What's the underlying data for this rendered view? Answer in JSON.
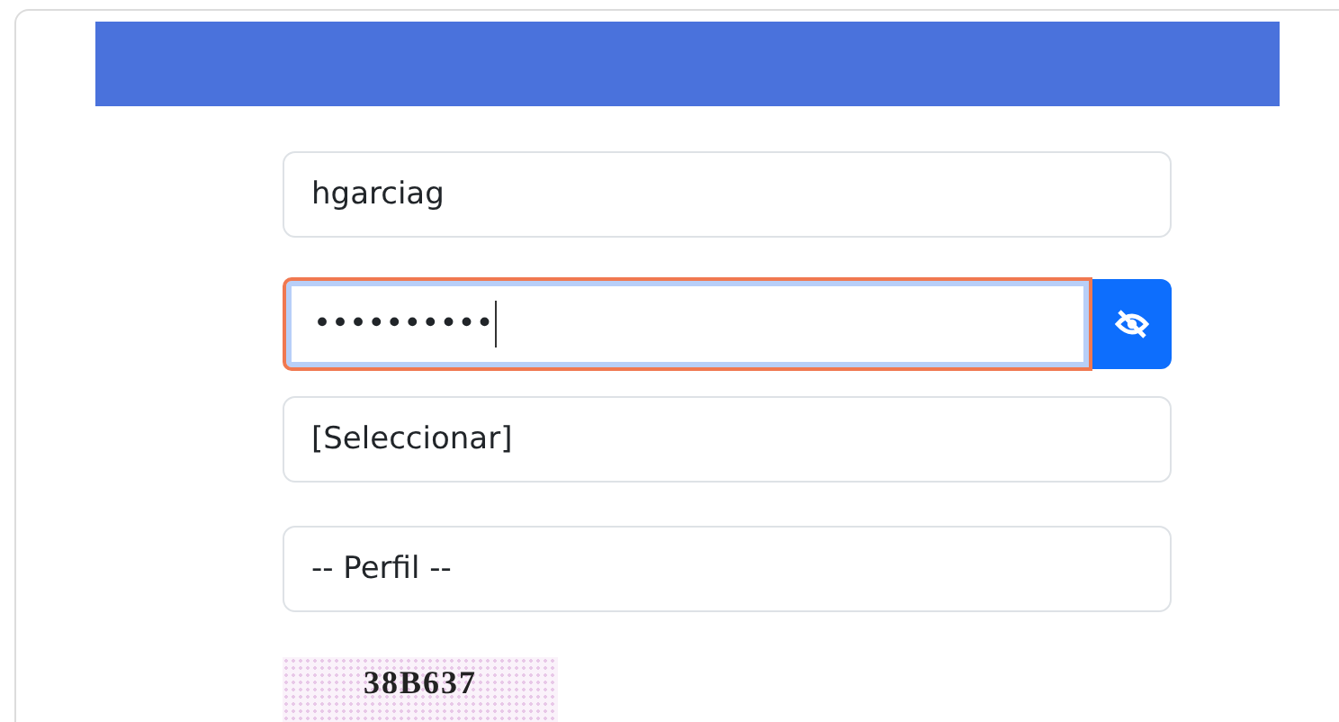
{
  "username": {
    "value": "hgarciag"
  },
  "password": {
    "value": "••••••••••",
    "focused": true
  },
  "select": {
    "value": "[Seleccionar]"
  },
  "profile": {
    "value": "-- Perfil --"
  },
  "captcha": {
    "text": "38B637"
  }
}
